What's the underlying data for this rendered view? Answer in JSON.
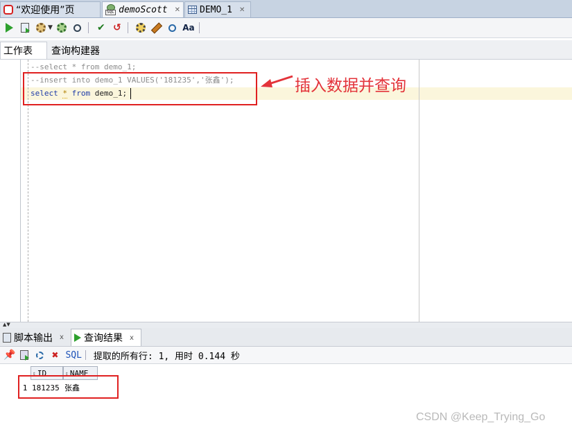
{
  "doc_tabs": [
    {
      "label": "“欢迎使用”页",
      "icon": "oracle-icon",
      "active": false
    },
    {
      "label": "demoScott",
      "icon": "sql-worksheet-icon",
      "active": true
    },
    {
      "label": "DEMO_1",
      "icon": "table-icon",
      "active": false
    }
  ],
  "sub_tabs": [
    "工作表",
    "查询构建器"
  ],
  "editor": {
    "line1": "--select * from demo_1;",
    "line2": "--insert into demo_1 VALUES('181235','张鑫');",
    "line3": {
      "kw1": "select",
      "star": "*",
      "kw2": "from",
      "rest": " demo_1;"
    },
    "annotation": "插入数据并查询"
  },
  "bottom_tabs": [
    {
      "label": "脚本输出",
      "close": "x"
    },
    {
      "label": "查询结果",
      "close": "x"
    }
  ],
  "result_toolbar": {
    "sql_label": "SQL",
    "status": "提取的所有行: 1, 用时 0.144 秒"
  },
  "grid": {
    "columns": [
      "ID",
      "NAME"
    ],
    "rows": [
      {
        "num": "1",
        "ID": "181235",
        "NAME": "张鑫"
      }
    ]
  },
  "watermark": "CSDN @Keep_Trying_Go",
  "colors": {
    "accent_red": "#e02020",
    "keyword": "#1d3ba8",
    "comment": "#8c8c8c"
  }
}
